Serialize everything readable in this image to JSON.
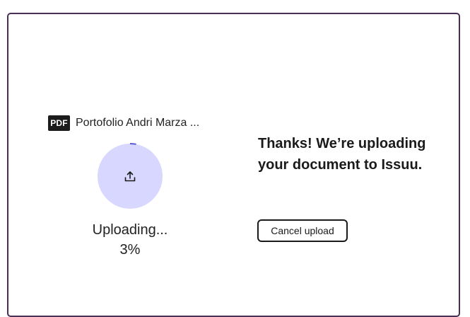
{
  "file": {
    "type_badge": "PDF",
    "name": "Portofolio Andri Marza ..."
  },
  "upload": {
    "status_label": "Uploading...",
    "progress_text": "3%",
    "progress_fraction": 0.03,
    "icon": "upload-icon"
  },
  "message": {
    "text": "Thanks! We’re uploading your document to Issuu."
  },
  "actions": {
    "cancel_label": "Cancel upload"
  },
  "colors": {
    "frame_border": "#4a2f55",
    "progress_track": "#d8d7ff",
    "progress_arc": "#5b5bd6"
  }
}
